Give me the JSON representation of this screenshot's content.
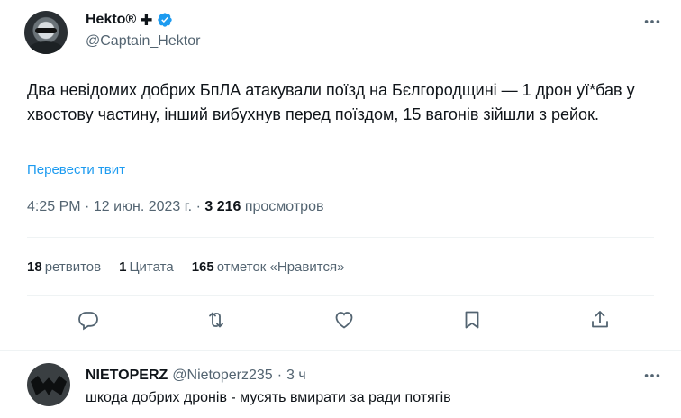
{
  "tweet": {
    "display_name": "Hekto®",
    "name_suffix": "✚",
    "handle": "@Captain_Hektor",
    "text": "Два невідомих добрих БпЛА атакували поїзд на Бєлгородщині — 1 дрон уї*бав у хвостову частину, інший вибухнув перед поїздом, 15 вагонів зійшли з рейок.",
    "translate_label": "Перевести твит",
    "time": "4:25 PM",
    "separator": "·",
    "date": "12 июн. 2023 г.",
    "views_count": "3 216",
    "views_label": "просмотров"
  },
  "stats": {
    "retweets_count": "18",
    "retweets_label": "ретвитов",
    "quotes_count": "1",
    "quotes_label": "Цитата",
    "likes_count": "165",
    "likes_label": "отметок «Нравится»"
  },
  "actions": {
    "icons": [
      "reply-icon",
      "retweet-icon",
      "like-icon",
      "bookmark-icon",
      "share-icon"
    ]
  },
  "reply": {
    "display_name": "NIETOPERZ",
    "handle": "@Nietoperz235",
    "separator": "·",
    "time": "3 ч",
    "text": "шкода добрих дронів - мусять вмирати за ради потягів"
  },
  "colors": {
    "accent": "#1d9bf0",
    "text": "#0f1419",
    "muted": "#536471",
    "divider": "#eff3f4"
  }
}
